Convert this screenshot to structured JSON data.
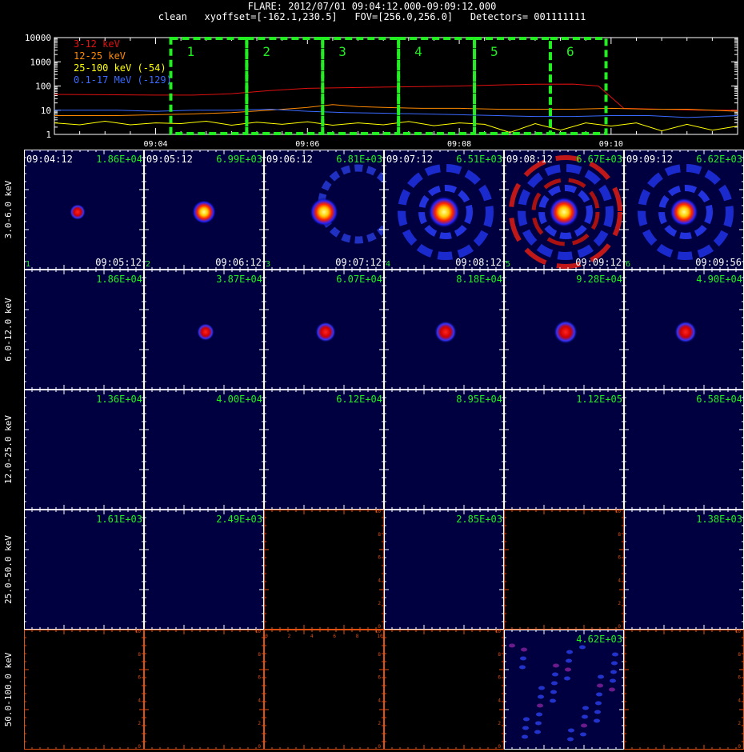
{
  "header": {
    "line1": "FLARE: 2012/07/01 09:04:12.000-09:09:12.000",
    "line2": "clean   xyoffset=[-162.1,230.5]   FOV=[256.0,256.0]   Detectors= 001111111"
  },
  "chart_data": [
    {
      "type": "line",
      "title": "",
      "yscale": "log",
      "ylim": [
        1,
        10000
      ],
      "ytick_labels": [
        "10000",
        "1000",
        "100",
        "10",
        "1"
      ],
      "xtick_labels": [
        "09:04",
        "09:06",
        "09:08",
        "09:10"
      ],
      "xlim_minutes": [
        "09:02:40",
        "09:11:40"
      ],
      "series": [
        {
          "name": "3-12 keV",
          "color": "#e01010",
          "x": [
            "09:02:40",
            "09:04:00",
            "09:04:30",
            "09:05:00",
            "09:05:30",
            "09:06:00",
            "09:06:30",
            "09:07:00",
            "09:07:30",
            "09:08:00",
            "09:08:30",
            "09:09:00",
            "09:09:30",
            "09:09:50",
            "09:10:10",
            "09:10:40",
            "09:11:10",
            "09:11:40"
          ],
          "y": [
            45,
            42,
            42,
            48,
            65,
            80,
            85,
            90,
            95,
            100,
            110,
            118,
            120,
            100,
            12,
            11,
            10,
            10
          ]
        },
        {
          "name": "12-25 keV",
          "color": "#ff8a00",
          "x": [
            "09:02:40",
            "09:03:30",
            "09:04:00",
            "09:04:30",
            "09:05:00",
            "09:05:30",
            "09:06:00",
            "09:06:20",
            "09:06:40",
            "09:07:00",
            "09:07:30",
            "09:08:00",
            "09:08:30",
            "09:09:00",
            "09:09:30",
            "09:10:00",
            "09:10:30",
            "09:11:00",
            "09:11:40"
          ],
          "y": [
            6,
            6,
            6.5,
            7,
            8,
            10,
            13,
            17,
            14,
            13,
            12,
            12,
            11,
            11,
            11,
            12,
            11,
            11,
            9
          ]
        },
        {
          "name": "25-100 keV (-54)",
          "color": "#ffff00",
          "x": [
            "09:02:40",
            "09:03:00",
            "09:03:20",
            "09:03:40",
            "09:04:00",
            "09:04:20",
            "09:04:40",
            "09:05:00",
            "09:05:20",
            "09:05:40",
            "09:06:00",
            "09:06:20",
            "09:06:40",
            "09:07:00",
            "09:07:20",
            "09:07:40",
            "09:08:00",
            "09:08:20",
            "09:08:40",
            "09:09:00",
            "09:09:20",
            "09:09:40",
            "09:10:00",
            "09:10:20",
            "09:10:40",
            "09:11:00",
            "09:11:20",
            "09:11:40"
          ],
          "y": [
            3,
            2.5,
            3.5,
            2.5,
            3,
            2.8,
            3.5,
            2.4,
            3.2,
            2.6,
            3.3,
            2.4,
            3,
            2.5,
            3.4,
            2.3,
            3,
            2.6,
            1.2,
            2.8,
            1.5,
            3,
            2.2,
            3,
            1.4,
            2.6,
            1.5,
            2.2
          ]
        },
        {
          "name": "0.1-17 MeV (-129)",
          "color": "#3a6aff",
          "x": [
            "09:02:40",
            "09:03:30",
            "09:04:00",
            "09:04:30",
            "09:05:00",
            "09:05:30",
            "09:06:00",
            "09:06:30",
            "09:07:00",
            "09:07:30",
            "09:08:00",
            "09:08:30",
            "09:09:00",
            "09:09:30",
            "09:10:00",
            "09:10:30",
            "09:11:00",
            "09:11:40"
          ],
          "y": [
            10,
            10,
            9,
            10,
            10,
            11,
            9,
            8,
            7.5,
            7,
            6.5,
            6,
            5.5,
            5.5,
            6,
            6,
            5,
            6
          ]
        }
      ],
      "intervals": {
        "labels": [
          "1",
          "2",
          "3",
          "4",
          "5",
          "6"
        ],
        "edges": [
          "09:04:12",
          "09:05:12",
          "09:06:12",
          "09:07:12",
          "09:08:12",
          "09:09:12",
          "09:09:56"
        ]
      }
    },
    {
      "type": "heatmap",
      "title": "",
      "energy_bands": [
        "3.0-6.0 keV",
        "6.0-12.0 keV",
        "12.0-25.0 keV",
        "25.0-50.0 keV",
        "50.0-100.0 keV"
      ],
      "columns": [
        {
          "index": "1",
          "start": "09:04:12",
          "end": "09:05:12"
        },
        {
          "index": "2",
          "start": "09:05:12",
          "end": "09:06:12"
        },
        {
          "index": "3",
          "start": "09:06:12",
          "end": "09:07:12"
        },
        {
          "index": "4",
          "start": "09:07:12",
          "end": "09:08:12"
        },
        {
          "index": "5",
          "start": "09:08:12",
          "end": "09:09:12"
        },
        {
          "index": "6",
          "start": "09:09:12",
          "end": "09:09:56"
        }
      ],
      "peak_values": [
        [
          "1.86E+04",
          "6.99E+03",
          "6.81E+03",
          "6.51E+03",
          "6.67E+03",
          "6.62E+03"
        ],
        [
          "1.86E+04",
          "3.87E+04",
          "6.07E+04",
          "8.18E+04",
          "9.28E+04",
          "4.90E+04"
        ],
        [
          "1.36E+04",
          "4.00E+04",
          "6.12E+04",
          "8.95E+04",
          "1.12E+05",
          "6.58E+04"
        ],
        [
          "1.61E+03",
          "2.49E+03",
          "",
          "2.85E+03",
          "",
          "1.38E+03"
        ],
        [
          "",
          "",
          "",
          "",
          "4.62E+03",
          ""
        ]
      ],
      "empty_tick_labels": [
        "0",
        "2",
        "4",
        "6",
        "8",
        "10"
      ]
    }
  ]
}
